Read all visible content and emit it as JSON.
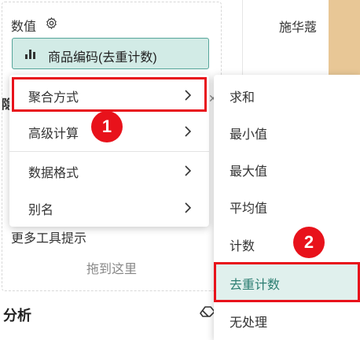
{
  "values_section": {
    "title": "数值",
    "chip_label": "商品编码(去重计数)"
  },
  "hidden_head": "隐",
  "more_tooltip": "更多工具提示",
  "drop_here": "拖到这里",
  "analysis": {
    "title": "分析"
  },
  "table": {
    "cell": "施华蔻"
  },
  "menu": {
    "items": [
      {
        "label": "聚合方式"
      },
      {
        "label": "高级计算"
      },
      {
        "label": "数据格式"
      },
      {
        "label": "别名"
      }
    ]
  },
  "submenu": {
    "items": [
      {
        "label": "求和"
      },
      {
        "label": "最小值"
      },
      {
        "label": "最大值"
      },
      {
        "label": "平均值"
      },
      {
        "label": "计数"
      },
      {
        "label": "去重计数"
      },
      {
        "label": "无处理"
      }
    ],
    "selected": "去重计数"
  },
  "badges": {
    "first": "1",
    "second": "2"
  },
  "colors": {
    "accent": "#2c7e72",
    "chip_bg": "#d2ebe6",
    "highlight": "#e8121b",
    "table_tan": "#e8c796"
  }
}
